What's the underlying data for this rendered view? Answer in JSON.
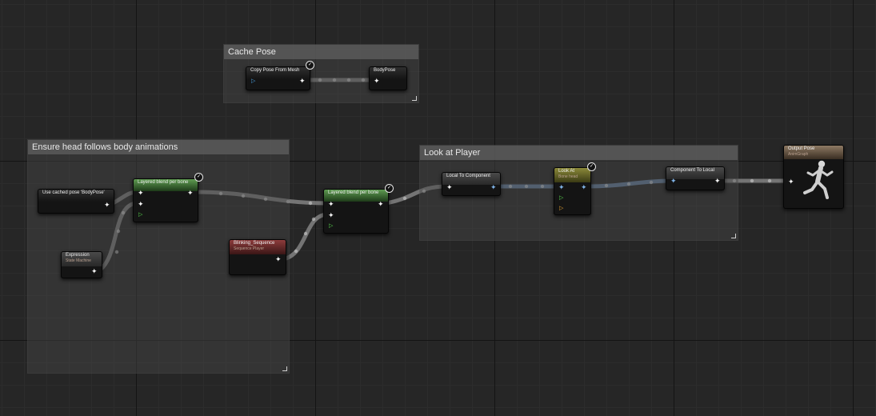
{
  "comments": {
    "cache_pose": "Cache Pose",
    "head_follows": "Ensure head follows body animations",
    "look_at_player": "Look at Player"
  },
  "nodes": {
    "copy_pose": {
      "title": "Copy Pose From Mesh"
    },
    "body_pose": {
      "title": "BodyPose"
    },
    "use_cached_pose": {
      "title": "Use cached pose 'BodyPose'"
    },
    "expression": {
      "title": "Expression",
      "subtitle": "State Machine"
    },
    "layered_blend_1": {
      "title": "Layered blend per bone"
    },
    "blinking_sequence": {
      "title": "Blinking_Sequence",
      "subtitle": "Sequence Player"
    },
    "layered_blend_2": {
      "title": "Layered blend per bone"
    },
    "local_to_component": {
      "title": "Local To Component"
    },
    "look_at": {
      "title": "Look At",
      "subtitle": "Bone head"
    },
    "component_to_local": {
      "title": "Component To Local"
    },
    "output_pose": {
      "title": "Output Pose",
      "subtitle": "AnimGraph"
    }
  },
  "icons": {
    "pose_pin": "running-figure-icon",
    "fast_path": "lightning-bolt-icon",
    "exec_pin": "exec-arrow-icon",
    "node_resize": "resize-corner-icon"
  },
  "colors": {
    "graph_background": "#262626",
    "pose_wire": "#9a9a9a",
    "component_wire": "#6e8fb4",
    "blend_header": "#5f9c52",
    "sequence_header": "#8e3c3c",
    "look_at_header": "#8c8a3a",
    "output_header": "#8e7a64"
  }
}
